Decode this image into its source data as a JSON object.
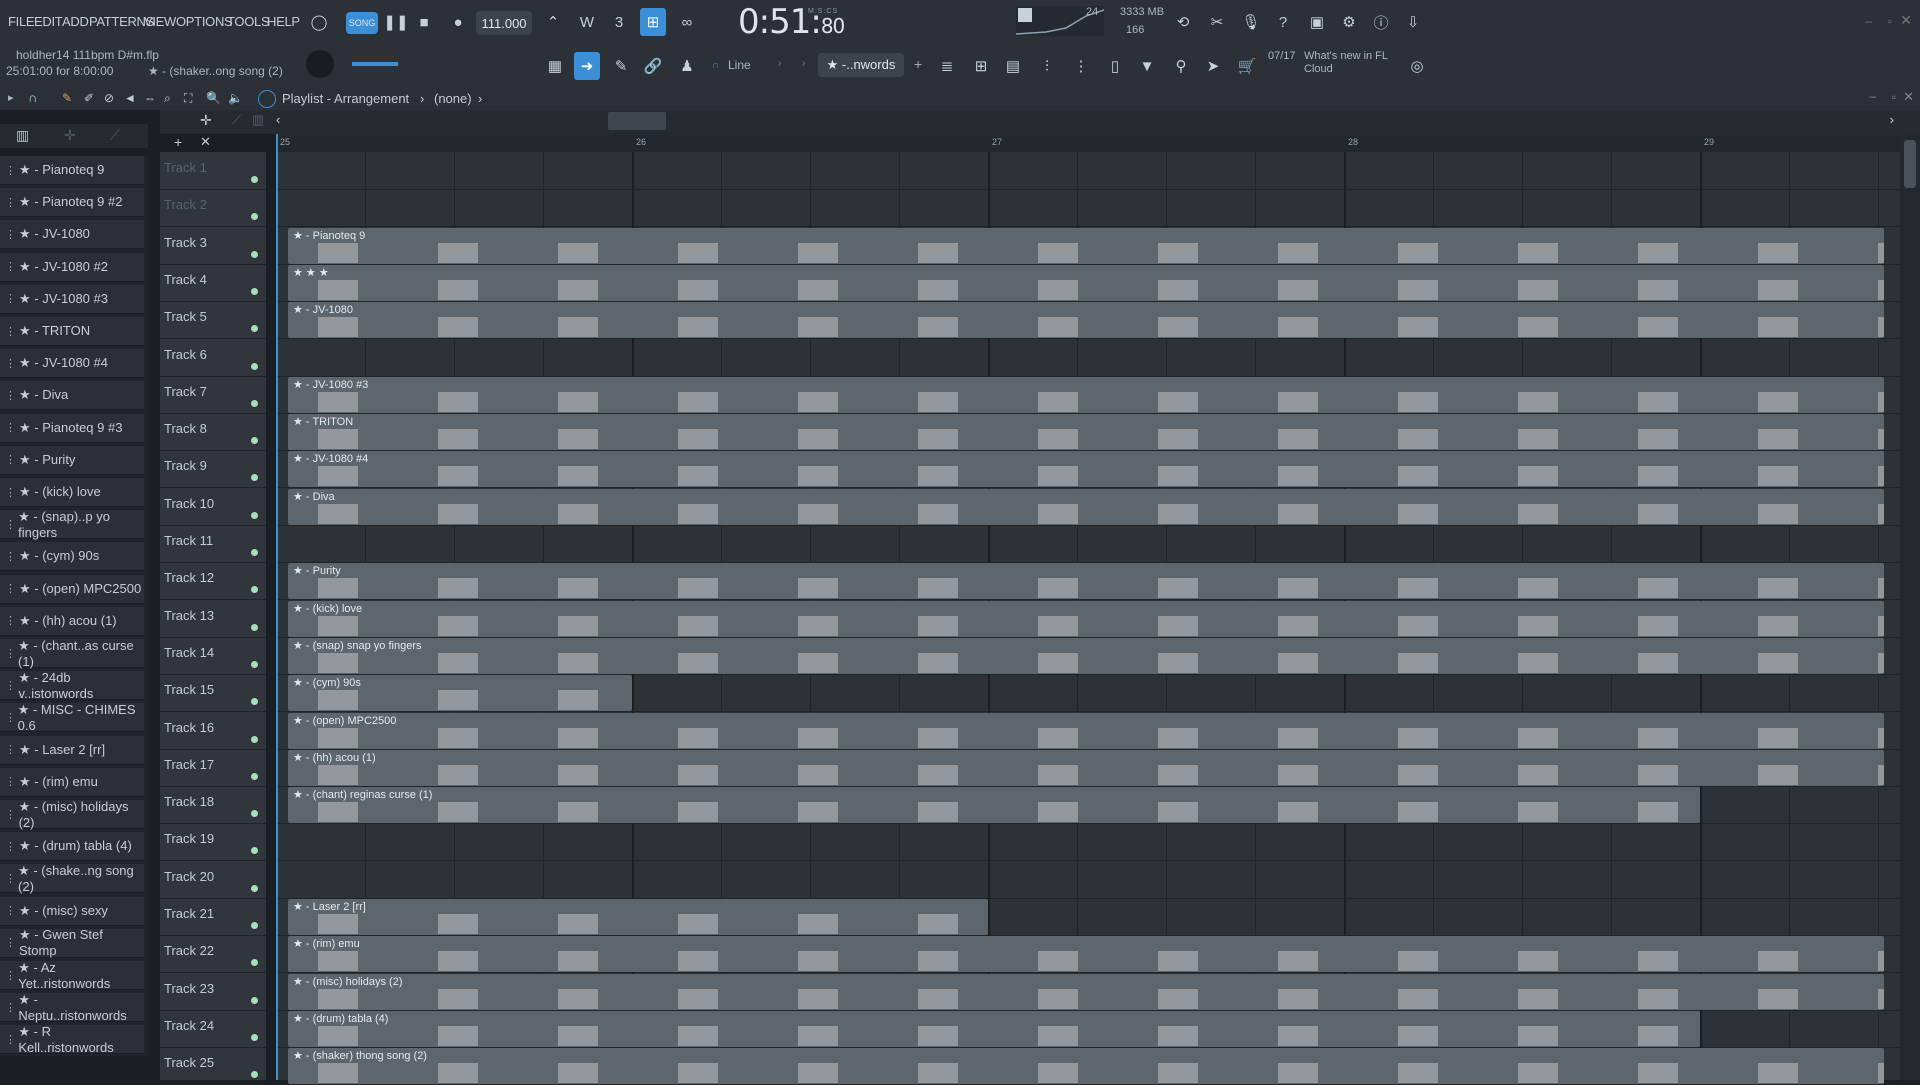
{
  "menu": [
    "FILE",
    "EDIT",
    "ADD",
    "PATTERNS",
    "VIEW",
    "OPTIONS",
    "TOOLS",
    "HELP"
  ],
  "transport": {
    "mode": "SONG",
    "tempo": "111.000",
    "time_main": "0:51",
    "time_sub": "80",
    "time_unit": "M:S:CS",
    "cpu": "24",
    "ram": "3333 MB",
    "poly": "166"
  },
  "project": {
    "file": "holdher14 111bpm D#m.flp",
    "hint_time": "25:01:00 for 8:00:00",
    "hint_pattern": "★ - (shaker..ong song (2)"
  },
  "snap": {
    "label": "Line",
    "pattern_select": "★ -..nwords"
  },
  "news": {
    "count": "07/17",
    "text": "What's new in FL Cloud"
  },
  "playlist": {
    "title": "Playlist - Arrangement",
    "sep": "›",
    "pattern": "(none)"
  },
  "ruler": [
    "25",
    "26",
    "27",
    "28",
    "29"
  ],
  "picker": [
    "★ - Pianoteq 9",
    "★ - Pianoteq 9 #2",
    "★ - JV-1080",
    "★ - JV-1080 #2",
    "★ - JV-1080 #3",
    "★ - TRITON",
    "★ - JV-1080 #4",
    "★ - Diva",
    "★ - Pianoteq 9 #3",
    "★ - Purity",
    "★ - (kick) love",
    "★ - (snap)..p yo fingers",
    "★ - (cym) 90s",
    "★ - (open) MPC2500",
    "★ - (hh) acou (1)",
    "★ - (chant..as curse (1)",
    "★ - 24db v..istonwords",
    "★ - MISC - CHIMES 0.6",
    "★ - Laser 2 [rr]",
    "★ - (rim) emu",
    "★ - (misc) holidays (2)",
    "★ - (drum) tabla (4)",
    "★ - (shake..ng song (2)",
    "★ - (misc) sexy",
    "★ - Gwen Stef Stomp",
    "★ - Az Yet..ristonwords",
    "★ - Neptu..ristonwords",
    "★ - R Kell..ristonwords"
  ],
  "tracks": [
    "Track 1",
    "Track 2",
    "Track 3",
    "Track 4",
    "Track 5",
    "Track 6",
    "Track 7",
    "Track 8",
    "Track 9",
    "Track 10",
    "Track 11",
    "Track 12",
    "Track 13",
    "Track 14",
    "Track 15",
    "Track 16",
    "Track 17",
    "Track 18",
    "Track 19",
    "Track 20",
    "Track 21",
    "Track 22",
    "Track 23",
    "Track 24",
    "Track 25"
  ],
  "clips": [
    {
      "track": 2,
      "label": "★ - Pianoteq 9",
      "end": "full"
    },
    {
      "track": 3,
      "label": "★ ★ ★",
      "end": "full"
    },
    {
      "track": 4,
      "label": "★ - JV-1080",
      "end": "full"
    },
    {
      "track": 6,
      "label": "★ - JV-1080 #3",
      "end": "full"
    },
    {
      "track": 7,
      "label": "★ - TRITON",
      "end": "full"
    },
    {
      "track": 8,
      "label": "★ - JV-1080 #4",
      "end": "full"
    },
    {
      "track": 9,
      "label": "★ - Diva",
      "end": "full"
    },
    {
      "track": 11,
      "label": "★ - Purity",
      "end": "full"
    },
    {
      "track": 12,
      "label": "★ - (kick) love",
      "end": "full"
    },
    {
      "track": 13,
      "label": "★ - (snap) snap yo fingers",
      "end": "full"
    },
    {
      "track": 14,
      "label": "★ - (cym) 90s",
      "end": "short"
    },
    {
      "track": 15,
      "label": "★ - (open) MPC2500",
      "end": "full"
    },
    {
      "track": 16,
      "label": "★ - (hh) acou (1)",
      "end": "full"
    },
    {
      "track": 17,
      "label": "★ - (chant) reginas curse (1)",
      "end": "long"
    },
    {
      "track": 20,
      "label": "★ - Laser 2 [rr]",
      "end": "mid"
    },
    {
      "track": 21,
      "label": "★ - (rim) emu",
      "end": "full"
    },
    {
      "track": 22,
      "label": "★ - (misc) holidays (2)",
      "end": "full"
    },
    {
      "track": 23,
      "label": "★ - (drum) tabla (4)",
      "end": "long"
    },
    {
      "track": 24,
      "label": "★ - (shaker) thong song (2)",
      "end": "full"
    }
  ]
}
